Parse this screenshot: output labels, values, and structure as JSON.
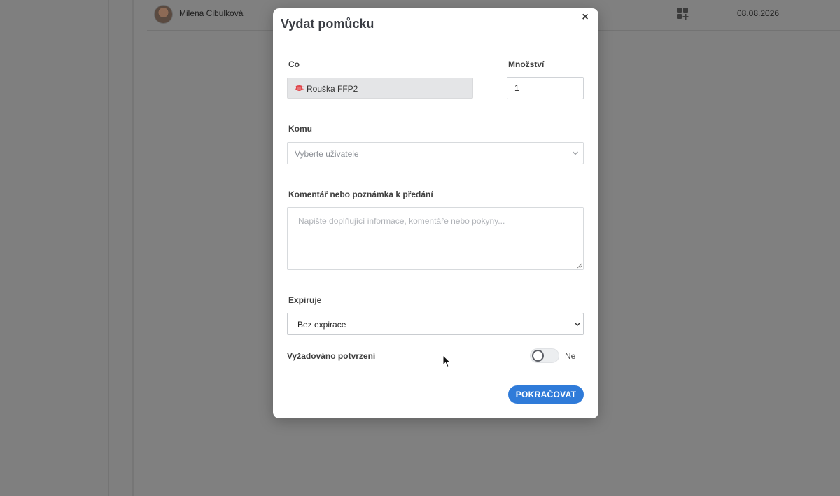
{
  "background": {
    "row": {
      "user_name": "Milena Cibulková",
      "date": "08.08.2026",
      "action_icon": "grid-plus-icon",
      "avatar_icon": "user-avatar"
    }
  },
  "modal": {
    "title": "Vydat pomůcku",
    "close_label": "×",
    "item": {
      "label": "Co",
      "value": "Rouška FFP2",
      "icon": "mask-icon",
      "icon_color": "#e0474c"
    },
    "quantity": {
      "label": "Množství",
      "value": "1"
    },
    "recipient": {
      "label": "Komu",
      "placeholder": "Vyberte uživatele"
    },
    "comment": {
      "label": "Komentář nebo poznámka k předání",
      "placeholder": "Napište doplňující informace, komentáře nebo pokyny..."
    },
    "expiry": {
      "label": "Expiruje",
      "value": "Bez expirace"
    },
    "confirmation": {
      "label": "Vyžadováno potvrzení",
      "toggle_on": false,
      "state_text": "Ne"
    },
    "continue_label": "POKRAČOVAT"
  },
  "colors": {
    "overlay": "#7f7f7f",
    "accent": "#2f7bd9",
    "modal_bg": "#ffffff"
  }
}
